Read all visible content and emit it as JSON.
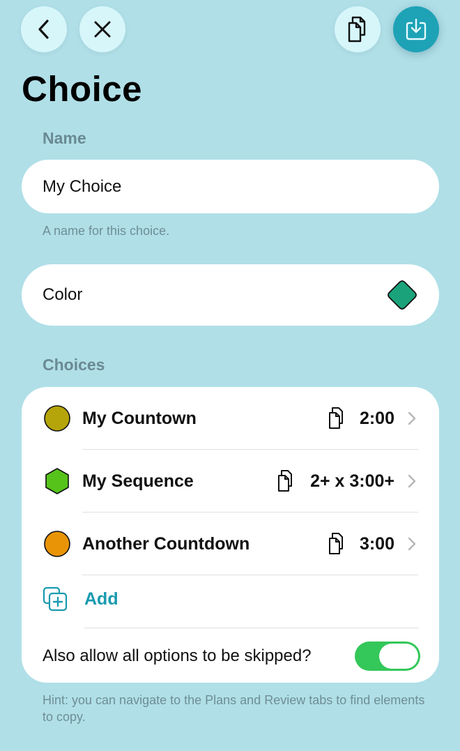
{
  "header": {
    "title": "Choice"
  },
  "name_section": {
    "label": "Name",
    "value": "My Choice",
    "hint": "A name for this choice."
  },
  "color_section": {
    "label": "Color",
    "swatch_color": "#1aa37a"
  },
  "choices_section": {
    "label": "Choices",
    "items": [
      {
        "name": "My Countown",
        "duration": "2:00",
        "marker_shape": "circle",
        "marker_color": "#b5a50a"
      },
      {
        "name": "My Sequence",
        "duration": "2+ x 3:00+",
        "marker_shape": "hexagon",
        "marker_color": "#55c31a"
      },
      {
        "name": "Another Countdown",
        "duration": "3:00",
        "marker_shape": "circle",
        "marker_color": "#e89406"
      }
    ],
    "add_label": "Add",
    "skip_label": "Also allow all options to be skipped?",
    "skip_enabled": true
  },
  "footer_hint": "Hint: you can navigate to the Plans and Review tabs to find elements to copy.",
  "colors": {
    "background": "#b0dfe8",
    "accent": "#1ea2b6",
    "toggle_on": "#34c759"
  }
}
